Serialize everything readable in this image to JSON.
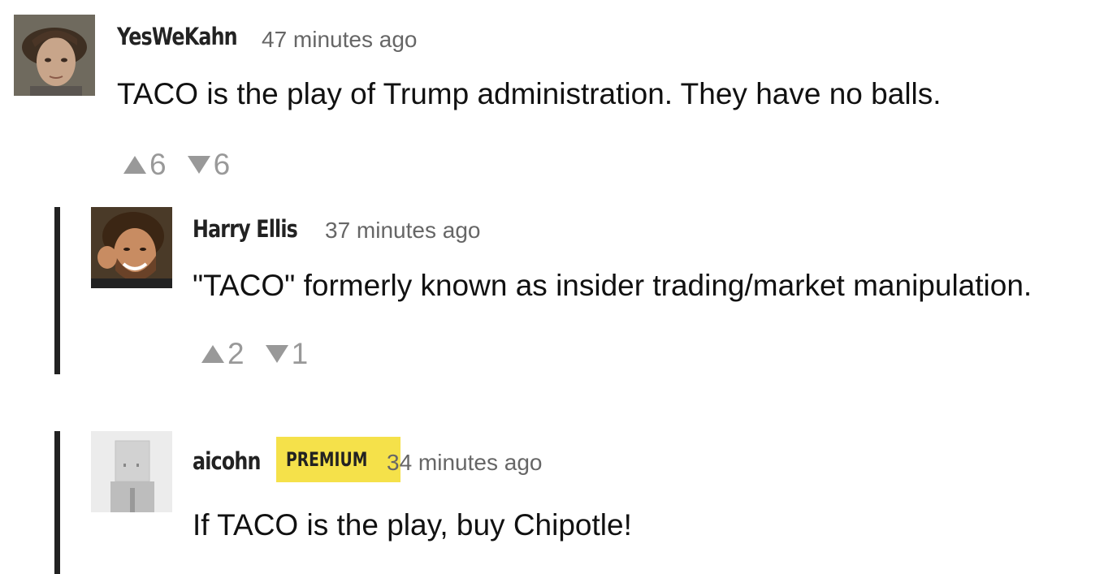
{
  "comments": [
    {
      "author": "YesWeKahn",
      "time": "47 minutes ago",
      "text": "TACO is the play of Trump administration. They have no balls.",
      "upvotes": "6",
      "downvotes": "6"
    },
    {
      "author": "Harry Ellis",
      "time": "37 minutes ago",
      "text": "\"TACO\" formerly known as insider trading/market manipulation.",
      "upvotes": "2",
      "downvotes": "1"
    },
    {
      "author": "aicohn",
      "badge": "PREMIUM",
      "time": "34 minutes ago",
      "text": "If TACO is the play, buy Chipotle!"
    }
  ],
  "colors": {
    "badge": "#f5e14a",
    "reply_bar": "#222222",
    "vote": "#999999",
    "meta": "#666666"
  },
  "icons": {
    "upvote": "triangle-up-icon",
    "downvote": "triangle-down-icon"
  }
}
